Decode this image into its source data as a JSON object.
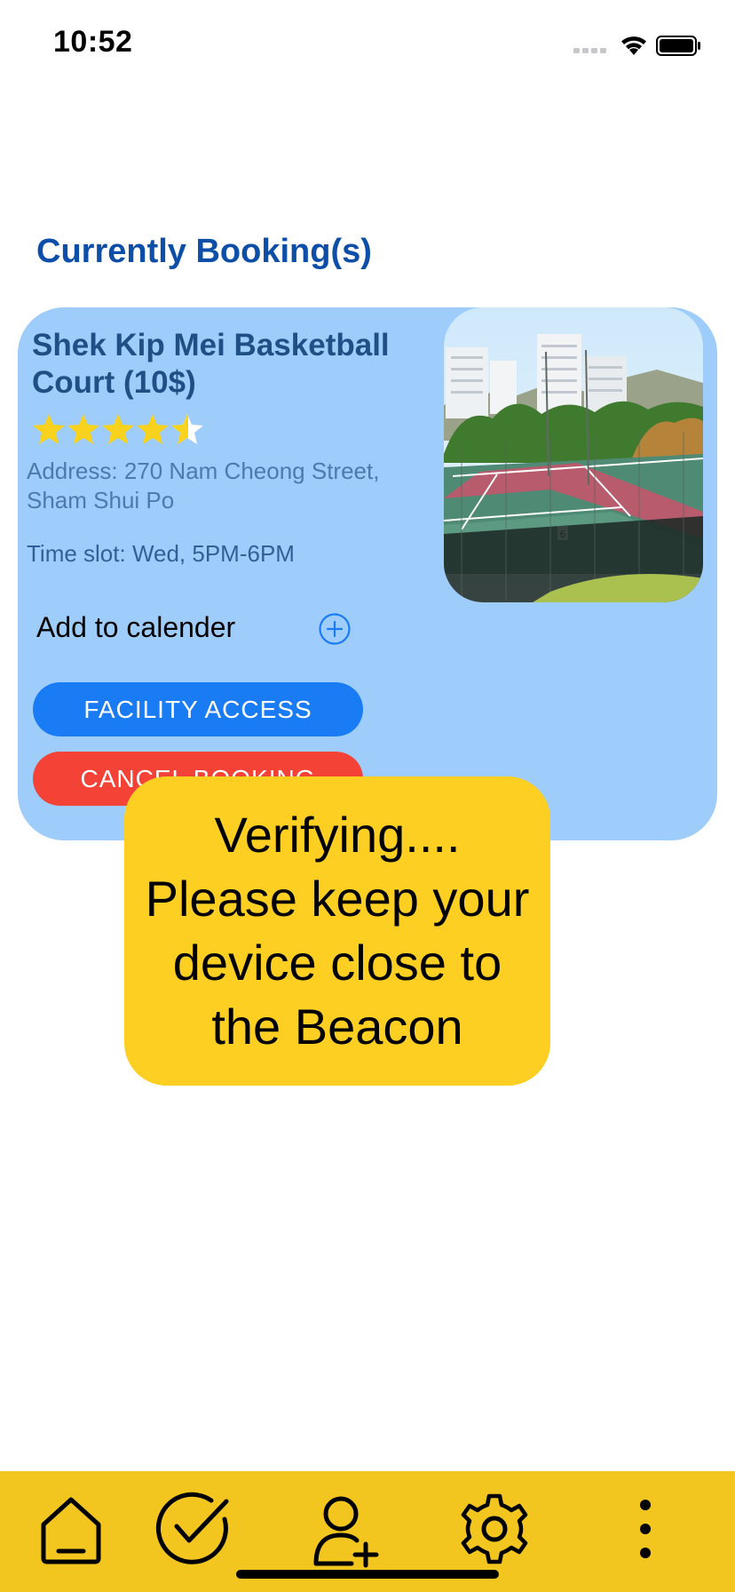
{
  "status_bar": {
    "time": "10:52",
    "icons": [
      "signal-icon",
      "wifi-icon",
      "battery-icon"
    ]
  },
  "section_title": "Currently Booking(s)",
  "booking": {
    "name": "Shek Kip Mei Basketball Court (10$)",
    "rating": 4.5,
    "address": "Address: 270 Nam Cheong Street, Sham Shui Po",
    "time_slot": "Time slot: Wed, 5PM-6PM",
    "calendar_label": "Add to calender",
    "access_button": "FACILITY ACCESS",
    "cancel_button": "CANCEL BOOKING"
  },
  "overlay": {
    "message": "Verifying....\nPlease keep your\ndevice close to\nthe Beacon"
  },
  "tab_bar": {
    "items": [
      "home-icon",
      "checkmark-icon",
      "add-user-icon",
      "gear-icon",
      "more-icon"
    ]
  },
  "colors": {
    "card_background": "#9ecdfb",
    "title_blue": "#0d4fa8",
    "access_button": "#1a7cf5",
    "cancel_button": "#f44336",
    "overlay_yellow": "#fccf22",
    "tab_bar_yellow": "#f2c61e",
    "star_gold": "#f8d21c"
  }
}
